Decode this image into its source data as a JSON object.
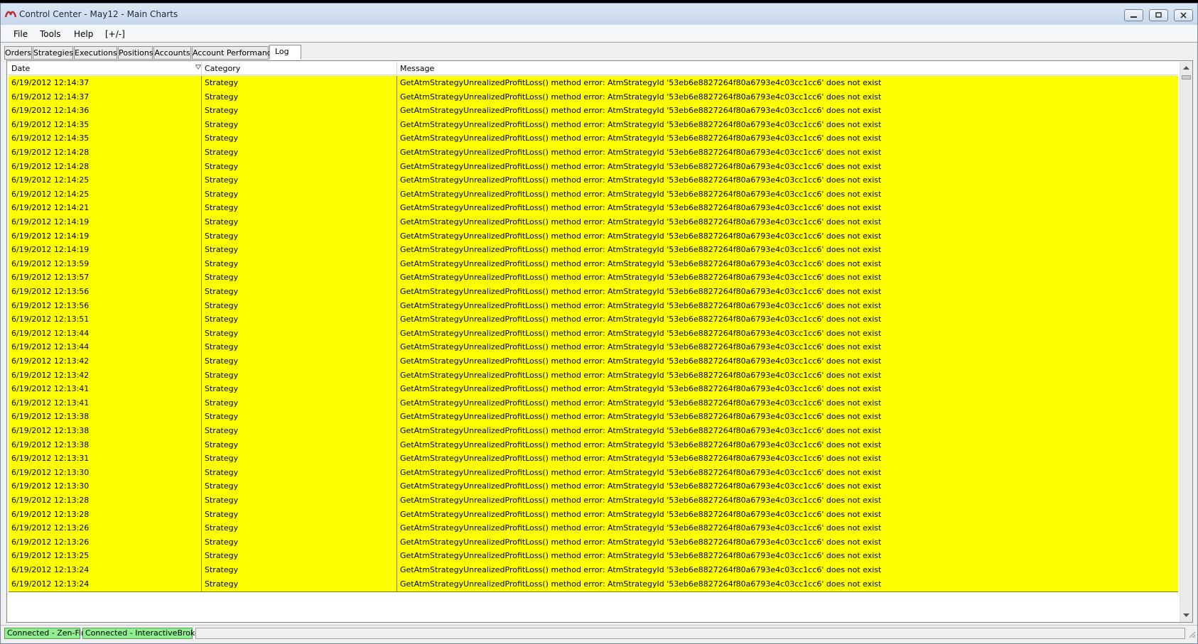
{
  "window": {
    "title": "Control Center - May12 - Main Charts"
  },
  "menu": {
    "file": "File",
    "tools": "Tools",
    "help": "Help",
    "plusminus": "[+/-]"
  },
  "tabs": [
    {
      "label": "Orders"
    },
    {
      "label": "Strategies"
    },
    {
      "label": "Executions"
    },
    {
      "label": "Positions"
    },
    {
      "label": "Accounts"
    },
    {
      "label": "Account Performance"
    },
    {
      "label": "Log",
      "active": true
    }
  ],
  "grid": {
    "columns": {
      "date": "Date",
      "category": "Category",
      "message": "Message"
    },
    "rows": [
      {
        "date": "6/19/2012 12:14:37",
        "category": "Strategy",
        "message": "GetAtmStrategyUnrealizedProfitLoss() method error: AtmStrategyId '53eb6e8827264f80a6793e4c03cc1cc6' does not exist"
      },
      {
        "date": "6/19/2012 12:14:37",
        "category": "Strategy",
        "message": "GetAtmStrategyUnrealizedProfitLoss() method error: AtmStrategyId '53eb6e8827264f80a6793e4c03cc1cc6' does not exist"
      },
      {
        "date": "6/19/2012 12:14:36",
        "category": "Strategy",
        "message": "GetAtmStrategyUnrealizedProfitLoss() method error: AtmStrategyId '53eb6e8827264f80a6793e4c03cc1cc6' does not exist"
      },
      {
        "date": "6/19/2012 12:14:35",
        "category": "Strategy",
        "message": "GetAtmStrategyUnrealizedProfitLoss() method error: AtmStrategyId '53eb6e8827264f80a6793e4c03cc1cc6' does not exist"
      },
      {
        "date": "6/19/2012 12:14:35",
        "category": "Strategy",
        "message": "GetAtmStrategyUnrealizedProfitLoss() method error: AtmStrategyId '53eb6e8827264f80a6793e4c03cc1cc6' does not exist"
      },
      {
        "date": "6/19/2012 12:14:28",
        "category": "Strategy",
        "message": "GetAtmStrategyUnrealizedProfitLoss() method error: AtmStrategyId '53eb6e8827264f80a6793e4c03cc1cc6' does not exist"
      },
      {
        "date": "6/19/2012 12:14:28",
        "category": "Strategy",
        "message": "GetAtmStrategyUnrealizedProfitLoss() method error: AtmStrategyId '53eb6e8827264f80a6793e4c03cc1cc6' does not exist"
      },
      {
        "date": "6/19/2012 12:14:25",
        "category": "Strategy",
        "message": "GetAtmStrategyUnrealizedProfitLoss() method error: AtmStrategyId '53eb6e8827264f80a6793e4c03cc1cc6' does not exist"
      },
      {
        "date": "6/19/2012 12:14:25",
        "category": "Strategy",
        "message": "GetAtmStrategyUnrealizedProfitLoss() method error: AtmStrategyId '53eb6e8827264f80a6793e4c03cc1cc6' does not exist"
      },
      {
        "date": "6/19/2012 12:14:21",
        "category": "Strategy",
        "message": "GetAtmStrategyUnrealizedProfitLoss() method error: AtmStrategyId '53eb6e8827264f80a6793e4c03cc1cc6' does not exist"
      },
      {
        "date": "6/19/2012 12:14:19",
        "category": "Strategy",
        "message": "GetAtmStrategyUnrealizedProfitLoss() method error: AtmStrategyId '53eb6e8827264f80a6793e4c03cc1cc6' does not exist"
      },
      {
        "date": "6/19/2012 12:14:19",
        "category": "Strategy",
        "message": "GetAtmStrategyUnrealizedProfitLoss() method error: AtmStrategyId '53eb6e8827264f80a6793e4c03cc1cc6' does not exist"
      },
      {
        "date": "6/19/2012 12:14:19",
        "category": "Strategy",
        "message": "GetAtmStrategyUnrealizedProfitLoss() method error: AtmStrategyId '53eb6e8827264f80a6793e4c03cc1cc6' does not exist"
      },
      {
        "date": "6/19/2012 12:13:59",
        "category": "Strategy",
        "message": "GetAtmStrategyUnrealizedProfitLoss() method error: AtmStrategyId '53eb6e8827264f80a6793e4c03cc1cc6' does not exist"
      },
      {
        "date": "6/19/2012 12:13:57",
        "category": "Strategy",
        "message": "GetAtmStrategyUnrealizedProfitLoss() method error: AtmStrategyId '53eb6e8827264f80a6793e4c03cc1cc6' does not exist"
      },
      {
        "date": "6/19/2012 12:13:56",
        "category": "Strategy",
        "message": "GetAtmStrategyUnrealizedProfitLoss() method error: AtmStrategyId '53eb6e8827264f80a6793e4c03cc1cc6' does not exist"
      },
      {
        "date": "6/19/2012 12:13:56",
        "category": "Strategy",
        "message": "GetAtmStrategyUnrealizedProfitLoss() method error: AtmStrategyId '53eb6e8827264f80a6793e4c03cc1cc6' does not exist"
      },
      {
        "date": "6/19/2012 12:13:51",
        "category": "Strategy",
        "message": "GetAtmStrategyUnrealizedProfitLoss() method error: AtmStrategyId '53eb6e8827264f80a6793e4c03cc1cc6' does not exist"
      },
      {
        "date": "6/19/2012 12:13:44",
        "category": "Strategy",
        "message": "GetAtmStrategyUnrealizedProfitLoss() method error: AtmStrategyId '53eb6e8827264f80a6793e4c03cc1cc6' does not exist"
      },
      {
        "date": "6/19/2012 12:13:44",
        "category": "Strategy",
        "message": "GetAtmStrategyUnrealizedProfitLoss() method error: AtmStrategyId '53eb6e8827264f80a6793e4c03cc1cc6' does not exist"
      },
      {
        "date": "6/19/2012 12:13:42",
        "category": "Strategy",
        "message": "GetAtmStrategyUnrealizedProfitLoss() method error: AtmStrategyId '53eb6e8827264f80a6793e4c03cc1cc6' does not exist"
      },
      {
        "date": "6/19/2012 12:13:42",
        "category": "Strategy",
        "message": "GetAtmStrategyUnrealizedProfitLoss() method error: AtmStrategyId '53eb6e8827264f80a6793e4c03cc1cc6' does not exist"
      },
      {
        "date": "6/19/2012 12:13:41",
        "category": "Strategy",
        "message": "GetAtmStrategyUnrealizedProfitLoss() method error: AtmStrategyId '53eb6e8827264f80a6793e4c03cc1cc6' does not exist"
      },
      {
        "date": "6/19/2012 12:13:41",
        "category": "Strategy",
        "message": "GetAtmStrategyUnrealizedProfitLoss() method error: AtmStrategyId '53eb6e8827264f80a6793e4c03cc1cc6' does not exist"
      },
      {
        "date": "6/19/2012 12:13:38",
        "category": "Strategy",
        "message": "GetAtmStrategyUnrealizedProfitLoss() method error: AtmStrategyId '53eb6e8827264f80a6793e4c03cc1cc6' does not exist"
      },
      {
        "date": "6/19/2012 12:13:38",
        "category": "Strategy",
        "message": "GetAtmStrategyUnrealizedProfitLoss() method error: AtmStrategyId '53eb6e8827264f80a6793e4c03cc1cc6' does not exist"
      },
      {
        "date": "6/19/2012 12:13:38",
        "category": "Strategy",
        "message": "GetAtmStrategyUnrealizedProfitLoss() method error: AtmStrategyId '53eb6e8827264f80a6793e4c03cc1cc6' does not exist"
      },
      {
        "date": "6/19/2012 12:13:31",
        "category": "Strategy",
        "message": "GetAtmStrategyUnrealizedProfitLoss() method error: AtmStrategyId '53eb6e8827264f80a6793e4c03cc1cc6' does not exist"
      },
      {
        "date": "6/19/2012 12:13:30",
        "category": "Strategy",
        "message": "GetAtmStrategyUnrealizedProfitLoss() method error: AtmStrategyId '53eb6e8827264f80a6793e4c03cc1cc6' does not exist"
      },
      {
        "date": "6/19/2012 12:13:30",
        "category": "Strategy",
        "message": "GetAtmStrategyUnrealizedProfitLoss() method error: AtmStrategyId '53eb6e8827264f80a6793e4c03cc1cc6' does not exist"
      },
      {
        "date": "6/19/2012 12:13:28",
        "category": "Strategy",
        "message": "GetAtmStrategyUnrealizedProfitLoss() method error: AtmStrategyId '53eb6e8827264f80a6793e4c03cc1cc6' does not exist"
      },
      {
        "date": "6/19/2012 12:13:28",
        "category": "Strategy",
        "message": "GetAtmStrategyUnrealizedProfitLoss() method error: AtmStrategyId '53eb6e8827264f80a6793e4c03cc1cc6' does not exist"
      },
      {
        "date": "6/19/2012 12:13:26",
        "category": "Strategy",
        "message": "GetAtmStrategyUnrealizedProfitLoss() method error: AtmStrategyId '53eb6e8827264f80a6793e4c03cc1cc6' does not exist"
      },
      {
        "date": "6/19/2012 12:13:26",
        "category": "Strategy",
        "message": "GetAtmStrategyUnrealizedProfitLoss() method error: AtmStrategyId '53eb6e8827264f80a6793e4c03cc1cc6' does not exist"
      },
      {
        "date": "6/19/2012 12:13:25",
        "category": "Strategy",
        "message": "GetAtmStrategyUnrealizedProfitLoss() method error: AtmStrategyId '53eb6e8827264f80a6793e4c03cc1cc6' does not exist"
      },
      {
        "date": "6/19/2012 12:13:24",
        "category": "Strategy",
        "message": "GetAtmStrategyUnrealizedProfitLoss() method error: AtmStrategyId '53eb6e8827264f80a6793e4c03cc1cc6' does not exist"
      },
      {
        "date": "6/19/2012 12:13:24",
        "category": "Strategy",
        "message": "GetAtmStrategyUnrealizedProfitLoss() method error: AtmStrategyId '53eb6e8827264f80a6793e4c03cc1cc6' does not exist"
      }
    ]
  },
  "status": {
    "zen_fire": "Connected - Zen-Fire",
    "interactive_brokers": "Connected - InteractiveBrokers"
  },
  "colors": {
    "row_background": "#ffff00",
    "row_border": "#808000",
    "connected_badge": "#90ee90"
  },
  "icons": {
    "app": "app-logo-icon",
    "sort": "sort-indicator-icon"
  }
}
